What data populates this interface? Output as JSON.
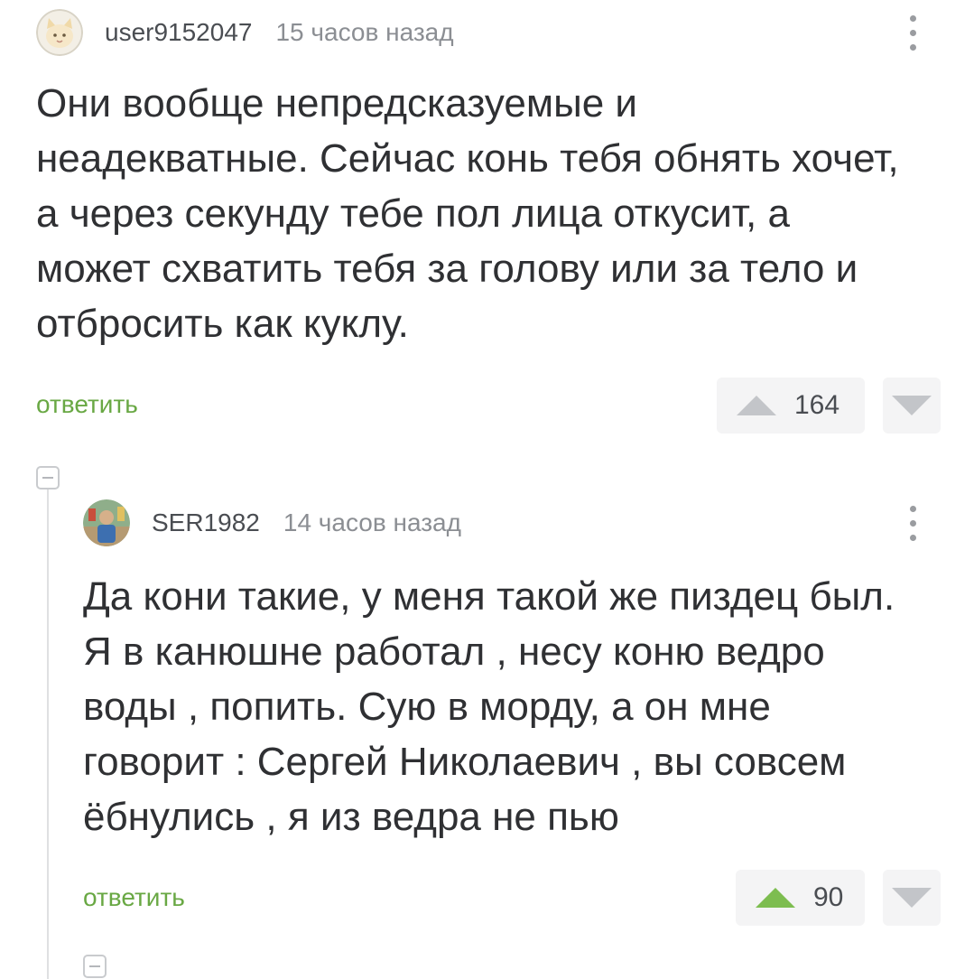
{
  "comments": [
    {
      "username": "user9152047",
      "time": "15 часов назад",
      "text": "Они вообще непредсказуемые и неадекватные. Сейчас конь тебя обнять хочет, а через секунду тебе пол лица откусит, а может схватить тебя за голову или за тело и отбросить как куклу.",
      "reply_label": "ответить",
      "rating": "164",
      "upvoted": false,
      "avatar_icon": "cat-avatar"
    },
    {
      "username": "SER1982",
      "time": "14 часов назад",
      "text": "Да кони такие, у меня такой же пиздец был. Я в канюшне работал , несу коню ведро воды , попить. Сую в морду, а он мне говорит : Сергей Николаевич , вы совсем ёбнулись , я из ведра не пью",
      "reply_label": "ответить",
      "rating": "90",
      "upvoted": true,
      "avatar_icon": "photo-avatar"
    }
  ],
  "colors": {
    "reply": "#69a844",
    "upvote_active": "#7dbd50",
    "vote_inactive": "#c3c5c9",
    "text": "#2f3033",
    "time": "#8b8e93"
  }
}
